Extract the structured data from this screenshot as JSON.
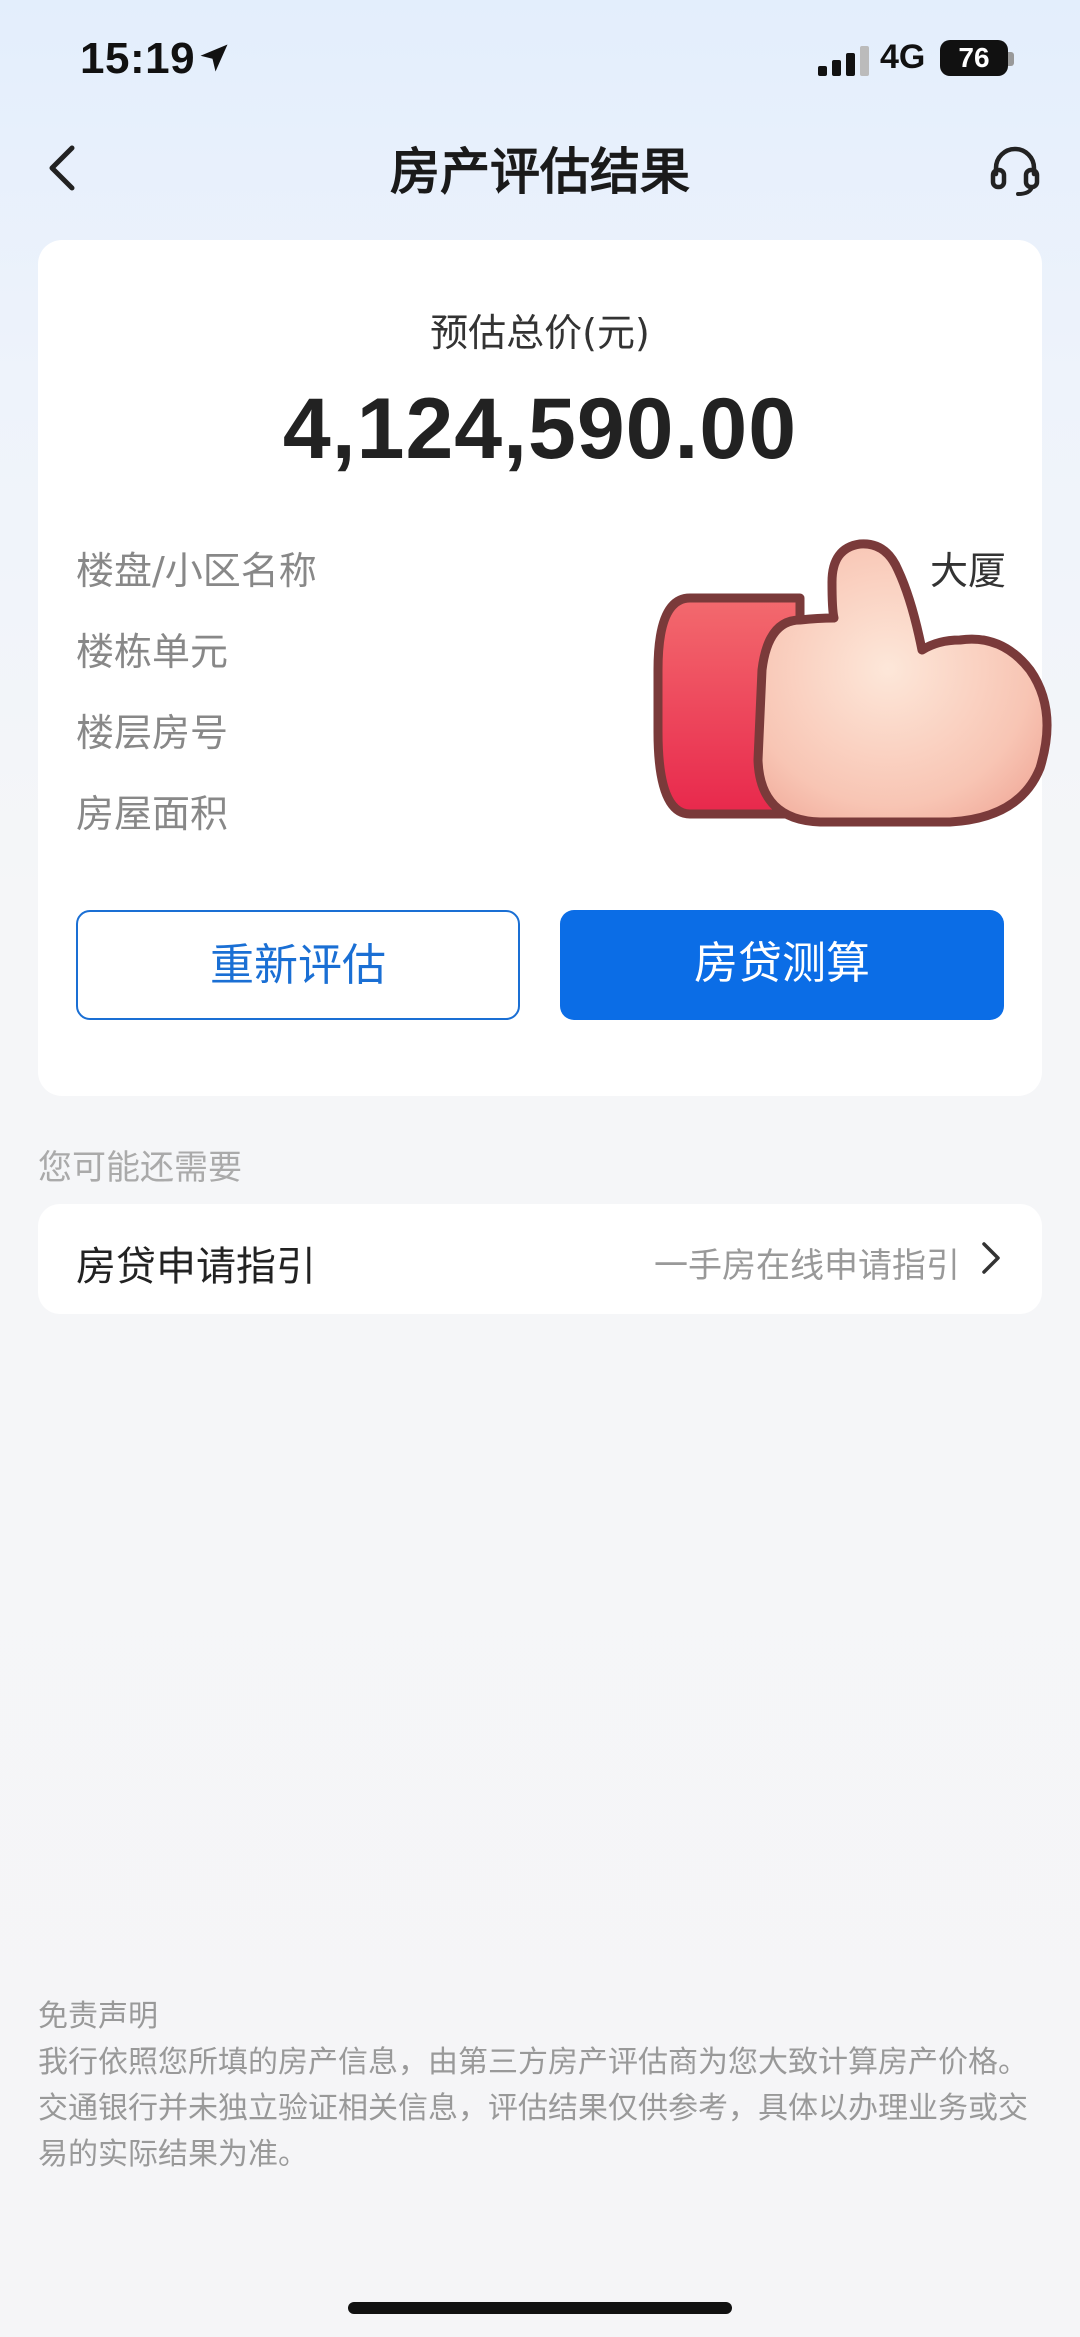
{
  "status_bar": {
    "time": "15:19",
    "network": "4G",
    "battery": "76"
  },
  "nav": {
    "title": "房产评估结果",
    "back_icon": "chevron-left-icon",
    "service_icon": "headset-icon"
  },
  "estimate": {
    "label": "预估总价(元)",
    "value": "4,124,590.00"
  },
  "details": [
    {
      "label": "楼盘/小区名称",
      "value": "大厦"
    },
    {
      "label": "楼栋单元",
      "value": ""
    },
    {
      "label": "楼层房号",
      "value": ""
    },
    {
      "label": "房屋面积",
      "value": ""
    }
  ],
  "buttons": {
    "reassess": "重新评估",
    "loan_calc": "房贷测算"
  },
  "colors": {
    "primary": "#0b6de6",
    "accent_outline": "#1a6fd4"
  },
  "more": {
    "hint": "您可能还需要",
    "guide_title": "房贷申请指引",
    "guide_sub": "一手房在线申请指引"
  },
  "disclaimer": {
    "title": "免责声明",
    "text": "我行依照您所填的房产信息，由第三方房产评估商为您大致计算房产价格。交通银行并未独立验证相关信息，评估结果仅供参考，具体以办理业务或交易的实际结果为准。"
  }
}
